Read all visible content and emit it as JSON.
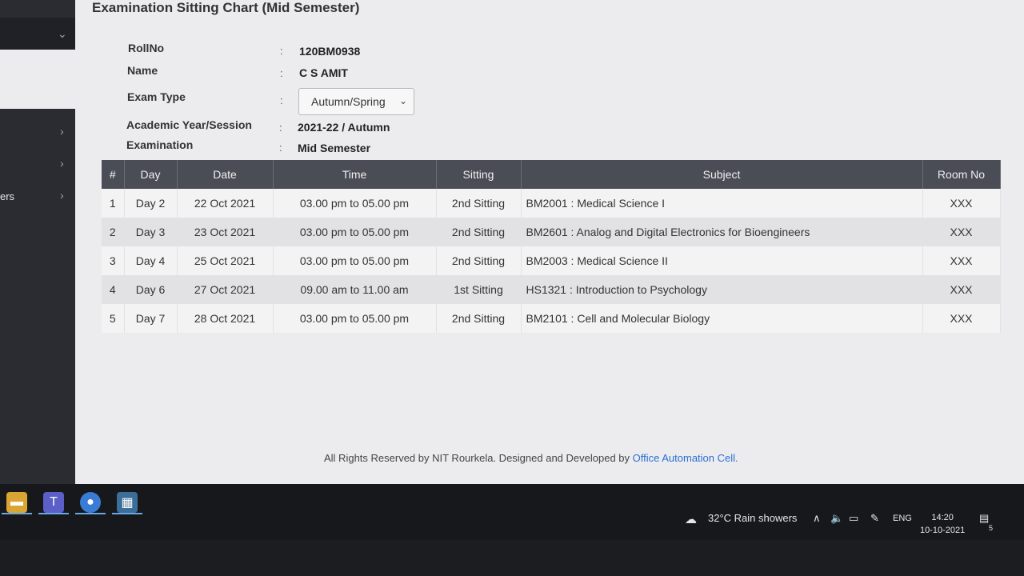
{
  "page": {
    "title": "Examination Sitting Chart (Mid Semester)"
  },
  "sidebar": {
    "partial_item": "ers"
  },
  "info": {
    "roll": {
      "label": "RollNo",
      "value": "120BM0938"
    },
    "name": {
      "label": "Name",
      "value": "C S AMIT"
    },
    "exam_type": {
      "label": "Exam Type",
      "selected": "Autumn/Spring"
    },
    "session": {
      "label": "Academic Year/Session",
      "value": "2021-22 / Autumn"
    },
    "examination": {
      "label": "Examination",
      "value": "Mid Semester"
    },
    "colon": ":"
  },
  "table": {
    "headers": [
      "#",
      "Day",
      "Date",
      "Time",
      "Sitting",
      "Subject",
      "Room No"
    ],
    "rows": [
      [
        "1",
        "Day 2",
        "22 Oct 2021",
        "03.00 pm to 05.00 pm",
        "2nd Sitting",
        "BM2001 : Medical Science I",
        "XXX"
      ],
      [
        "2",
        "Day 3",
        "23 Oct 2021",
        "03.00 pm to 05.00 pm",
        "2nd Sitting",
        "BM2601 : Analog and Digital Electronics for Bioengineers",
        "XXX"
      ],
      [
        "3",
        "Day 4",
        "25 Oct 2021",
        "03.00 pm to 05.00 pm",
        "2nd Sitting",
        "BM2003 : Medical Science II",
        "XXX"
      ],
      [
        "4",
        "Day 6",
        "27 Oct 2021",
        "09.00 am to 11.00 am",
        "1st Sitting",
        "HS1321 : Introduction to Psychology",
        "XXX"
      ],
      [
        "5",
        "Day 7",
        "28 Oct 2021",
        "03.00 pm to 05.00 pm",
        "2nd Sitting",
        "BM2101 : Cell and Molecular Biology",
        "XXX"
      ]
    ]
  },
  "footer": {
    "text": "All Rights Reserved by NIT Rourkela. Designed and Developed by ",
    "link": "Office Automation Cell."
  },
  "taskbar": {
    "weather": "32°C  Rain showers",
    "lang": "ENG",
    "time": "14:20",
    "date": "10-10-2021",
    "notifications": "5"
  }
}
